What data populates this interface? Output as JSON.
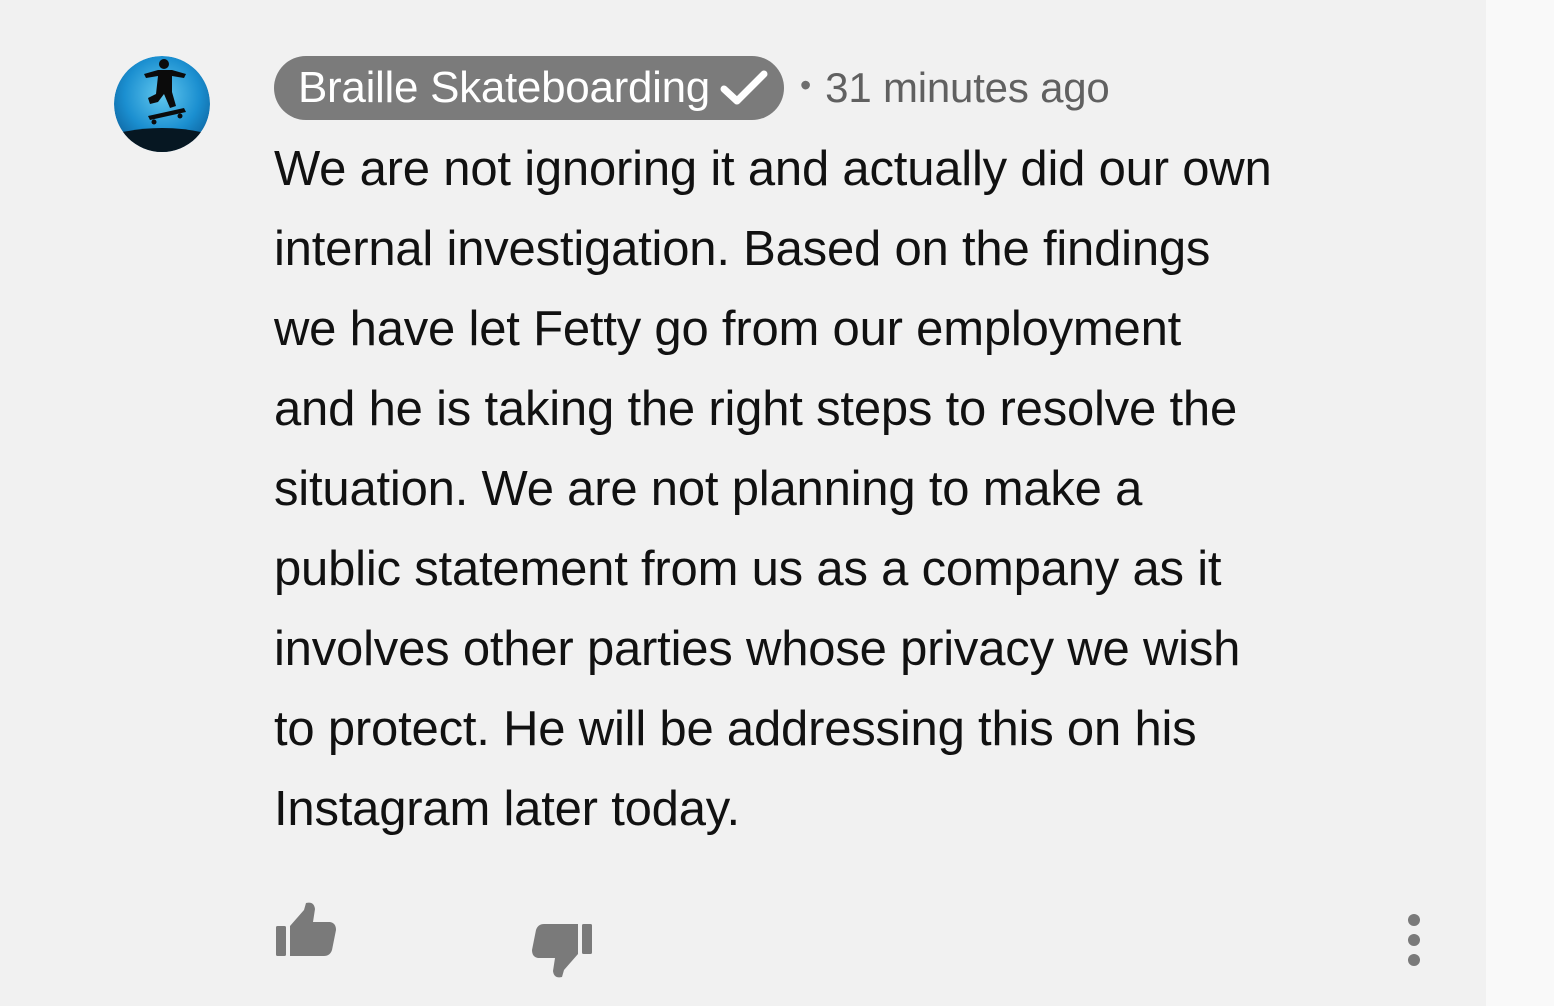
{
  "comment": {
    "author": "Braille Skateboarding",
    "separator": "•",
    "timestamp": "31 minutes ago",
    "body": "We are not ignoring it and actually did our own\ninternal investigation.  Based on the findings\nwe have let Fetty go from our employment\nand he is taking the right steps to resolve the\nsituation.  We are not planning to make a\npublic statement from us as a company as it\ninvolves other parties whose privacy we wish\nto protect.  He will be addressing this on his\nInstagram later today."
  },
  "icons": {
    "avatar": "skateboarder-avatar",
    "verified": "checkmark-icon",
    "like": "thumbs-up-icon",
    "dislike": "thumbs-down-icon",
    "more": "more-vertical-icon"
  },
  "colors": {
    "background": "#f1f1f1",
    "author_chip": "#7b7b7b",
    "author_text": "#ffffff",
    "timestamp": "#606060",
    "body_text": "#111111",
    "icons": "#7a7a7a"
  }
}
